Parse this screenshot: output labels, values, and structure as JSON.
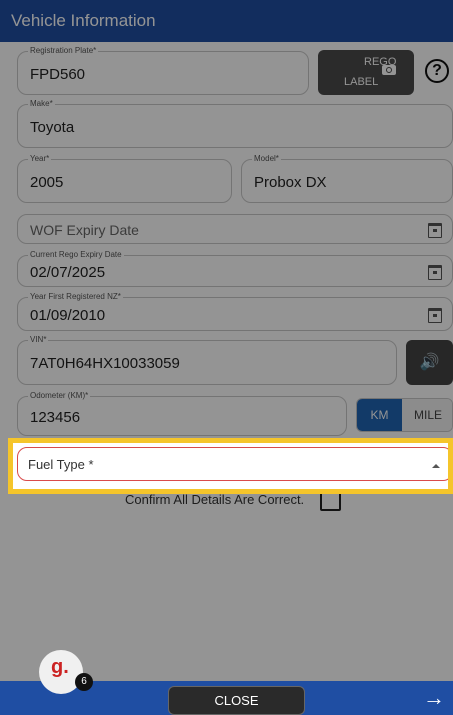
{
  "header": {
    "title": "Vehicle Information"
  },
  "registration": {
    "label": "Registration Plate*",
    "value": "FPD560"
  },
  "rego_button": {
    "line1": "REGO",
    "line2": "LABEL"
  },
  "make": {
    "label": "Make*",
    "value": "Toyota"
  },
  "year": {
    "label": "Year*",
    "value": "2005"
  },
  "model": {
    "label": "Model*",
    "value": "Probox DX"
  },
  "wof": {
    "placeholder": "WOF Expiry Date"
  },
  "rego_expiry": {
    "label": "Current Rego Expiry Date",
    "value": "02/07/2025"
  },
  "first_registered": {
    "label": "Year First Registered NZ*",
    "value": "01/09/2010"
  },
  "vin": {
    "label": "VIN*",
    "value": "7AT0H64HX10033059"
  },
  "odometer": {
    "label": "Odometer (KM)*",
    "value": "123456"
  },
  "unit_toggle": {
    "km": "KM",
    "mile": "MILE",
    "selected": "KM"
  },
  "fuel": {
    "placeholder": "Fuel Type *"
  },
  "confirm": {
    "label": "Confirm All Details Are Correct."
  },
  "footer": {
    "close_label": "CLOSE",
    "arrow": "→"
  },
  "logo": {
    "letter": "g.",
    "badge": "6"
  },
  "icons": {
    "help": "?",
    "speaker": "🔊"
  },
  "colors": {
    "primary": "#1f4ea3",
    "accent": "#1f64b3",
    "highlight": "#f5c52b",
    "error": "#d94b4b"
  }
}
